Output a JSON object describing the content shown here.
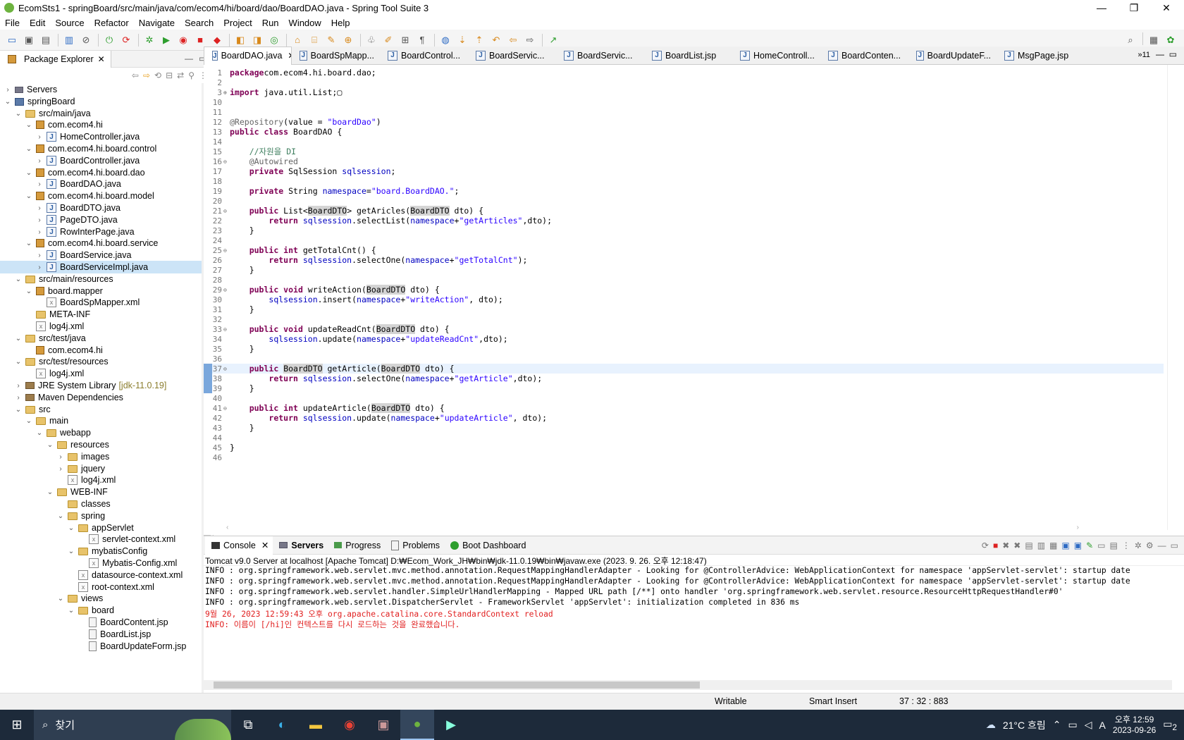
{
  "window": {
    "title": "EcomSts1 - springBoard/src/main/java/com/ecom4/hi/board/dao/BoardDAO.java - Spring Tool Suite 3",
    "minimize": "—",
    "maximize": "❐",
    "close": "✕"
  },
  "menu": [
    "File",
    "Edit",
    "Source",
    "Refactor",
    "Navigate",
    "Search",
    "Project",
    "Run",
    "Window",
    "Help"
  ],
  "package_explorer": {
    "tab_label": "Package Explorer",
    "tree": [
      {
        "depth": 0,
        "tw": "›",
        "icon": "srv",
        "label": "Servers"
      },
      {
        "depth": 0,
        "tw": "⌄",
        "icon": "proj",
        "label": "springBoard"
      },
      {
        "depth": 1,
        "tw": "⌄",
        "icon": "folder",
        "label": "src/main/java"
      },
      {
        "depth": 2,
        "tw": "⌄",
        "icon": "pkg",
        "label": "com.ecom4.hi"
      },
      {
        "depth": 3,
        "tw": "›",
        "icon": "java",
        "label": "HomeController.java"
      },
      {
        "depth": 2,
        "tw": "⌄",
        "icon": "pkg",
        "label": "com.ecom4.hi.board.control"
      },
      {
        "depth": 3,
        "tw": "›",
        "icon": "java",
        "label": "BoardController.java"
      },
      {
        "depth": 2,
        "tw": "⌄",
        "icon": "pkg",
        "label": "com.ecom4.hi.board.dao"
      },
      {
        "depth": 3,
        "tw": "›",
        "icon": "java",
        "label": "BoardDAO.java"
      },
      {
        "depth": 2,
        "tw": "⌄",
        "icon": "pkg",
        "label": "com.ecom4.hi.board.model"
      },
      {
        "depth": 3,
        "tw": "›",
        "icon": "java",
        "label": "BoardDTO.java"
      },
      {
        "depth": 3,
        "tw": "›",
        "icon": "java",
        "label": "PageDTO.java"
      },
      {
        "depth": 3,
        "tw": "›",
        "icon": "java",
        "label": "RowInterPage.java"
      },
      {
        "depth": 2,
        "tw": "⌄",
        "icon": "pkg",
        "label": "com.ecom4.hi.board.service"
      },
      {
        "depth": 3,
        "tw": "›",
        "icon": "java",
        "label": "BoardService.java"
      },
      {
        "depth": 3,
        "tw": "›",
        "icon": "java",
        "label": "BoardServiceImpl.java",
        "selected": true
      },
      {
        "depth": 1,
        "tw": "⌄",
        "icon": "folder",
        "label": "src/main/resources"
      },
      {
        "depth": 2,
        "tw": "⌄",
        "icon": "pkg",
        "label": "board.mapper"
      },
      {
        "depth": 3,
        "tw": "",
        "icon": "xml",
        "label": "BoardSpMapper.xml"
      },
      {
        "depth": 2,
        "tw": "",
        "icon": "folder",
        "label": "META-INF"
      },
      {
        "depth": 2,
        "tw": "",
        "icon": "xml",
        "label": "log4j.xml"
      },
      {
        "depth": 1,
        "tw": "⌄",
        "icon": "folder",
        "label": "src/test/java"
      },
      {
        "depth": 2,
        "tw": "",
        "icon": "pkg",
        "label": "com.ecom4.hi"
      },
      {
        "depth": 1,
        "tw": "⌄",
        "icon": "folder",
        "label": "src/test/resources"
      },
      {
        "depth": 2,
        "tw": "",
        "icon": "xml",
        "label": "log4j.xml"
      },
      {
        "depth": 1,
        "tw": "›",
        "icon": "lib",
        "label": "JRE System Library",
        "extra": "[jdk-11.0.19]"
      },
      {
        "depth": 1,
        "tw": "›",
        "icon": "lib",
        "label": "Maven Dependencies"
      },
      {
        "depth": 1,
        "tw": "⌄",
        "icon": "folder",
        "label": "src"
      },
      {
        "depth": 2,
        "tw": "⌄",
        "icon": "folder",
        "label": "main"
      },
      {
        "depth": 3,
        "tw": "⌄",
        "icon": "folder",
        "label": "webapp"
      },
      {
        "depth": 4,
        "tw": "⌄",
        "icon": "folder",
        "label": "resources"
      },
      {
        "depth": 5,
        "tw": "›",
        "icon": "folder",
        "label": "images"
      },
      {
        "depth": 5,
        "tw": "›",
        "icon": "folder",
        "label": "jquery"
      },
      {
        "depth": 5,
        "tw": "",
        "icon": "xml",
        "label": "log4j.xml"
      },
      {
        "depth": 4,
        "tw": "⌄",
        "icon": "folder",
        "label": "WEB-INF"
      },
      {
        "depth": 5,
        "tw": "",
        "icon": "folder",
        "label": "classes"
      },
      {
        "depth": 5,
        "tw": "⌄",
        "icon": "folder",
        "label": "spring"
      },
      {
        "depth": 6,
        "tw": "⌄",
        "icon": "folder",
        "label": "appServlet"
      },
      {
        "depth": 7,
        "tw": "",
        "icon": "xml",
        "label": "servlet-context.xml"
      },
      {
        "depth": 6,
        "tw": "⌄",
        "icon": "folder",
        "label": "mybatisConfig"
      },
      {
        "depth": 7,
        "tw": "",
        "icon": "xml",
        "label": "Mybatis-Config.xml"
      },
      {
        "depth": 6,
        "tw": "",
        "icon": "xml",
        "label": "datasource-context.xml"
      },
      {
        "depth": 6,
        "tw": "",
        "icon": "xml",
        "label": "root-context.xml"
      },
      {
        "depth": 5,
        "tw": "⌄",
        "icon": "folder",
        "label": "views"
      },
      {
        "depth": 6,
        "tw": "⌄",
        "icon": "folder",
        "label": "board"
      },
      {
        "depth": 7,
        "tw": "",
        "icon": "jsp",
        "label": "BoardContent.jsp"
      },
      {
        "depth": 7,
        "tw": "",
        "icon": "jsp",
        "label": "BoardList.jsp"
      },
      {
        "depth": 7,
        "tw": "",
        "icon": "jsp",
        "label": "BoardUpdateForm.jsp"
      }
    ]
  },
  "editor": {
    "tabs": [
      "BoardDAO.java",
      "BoardSpMapp...",
      "BoardControl...",
      "BoardServic...",
      "BoardServic...",
      "BoardList.jsp",
      "HomeControll...",
      "BoardConten...",
      "BoardUpdateF...",
      "MsgPage.jsp"
    ],
    "overflow_count": "»11",
    "lines": [
      {
        "n": "1",
        "toks": [
          [
            "kw",
            "package"
          ],
          [
            "",
            "com.ecom4.hi.board.dao;"
          ]
        ]
      },
      {
        "n": "2",
        "toks": []
      },
      {
        "n": "3",
        "fold": "⊕",
        "toks": [
          [
            "kw",
            "import"
          ],
          [
            "",
            " java.util.List;▢"
          ]
        ]
      },
      {
        "n": "10",
        "toks": []
      },
      {
        "n": "11",
        "toks": []
      },
      {
        "n": "12",
        "toks": [
          [
            "ann",
            "@Repository"
          ],
          [
            "",
            "(value = "
          ],
          [
            "str",
            "\"boardDao\""
          ],
          [
            "",
            ")"
          ]
        ]
      },
      {
        "n": "13",
        "toks": [
          [
            "kw",
            "public class"
          ],
          [
            "",
            " BoardDAO {"
          ]
        ]
      },
      {
        "n": "14",
        "toks": []
      },
      {
        "n": "15",
        "toks": [
          [
            "",
            "    "
          ],
          [
            "cmt",
            "//자원을 DI"
          ]
        ]
      },
      {
        "n": "16",
        "fold": "⊖",
        "toks": [
          [
            "",
            "    "
          ],
          [
            "ann",
            "@Autowired"
          ]
        ]
      },
      {
        "n": "17",
        "toks": [
          [
            "",
            "    "
          ],
          [
            "kw",
            "private"
          ],
          [
            "",
            " SqlSession "
          ],
          [
            "fld",
            "sqlsession"
          ],
          [
            "",
            ";"
          ]
        ]
      },
      {
        "n": "18",
        "toks": []
      },
      {
        "n": "19",
        "toks": [
          [
            "",
            "    "
          ],
          [
            "kw",
            "private"
          ],
          [
            "",
            " String "
          ],
          [
            "fld",
            "namespace"
          ],
          [
            "",
            "="
          ],
          [
            "str",
            "\"board.BoardDAO.\""
          ],
          [
            "",
            ";"
          ]
        ]
      },
      {
        "n": "20",
        "toks": []
      },
      {
        "n": "21",
        "fold": "⊖",
        "toks": [
          [
            "",
            "    "
          ],
          [
            "kw",
            "public"
          ],
          [
            "",
            " List<"
          ],
          [
            "hl",
            "BoardDTO"
          ],
          [
            "",
            "> getAricles("
          ],
          [
            "hl",
            "BoardDTO"
          ],
          [
            "",
            " dto) {"
          ]
        ]
      },
      {
        "n": "22",
        "toks": [
          [
            "",
            "        "
          ],
          [
            "kw",
            "return"
          ],
          [
            "",
            " "
          ],
          [
            "fld",
            "sqlsession"
          ],
          [
            "",
            ".selectList("
          ],
          [
            "fld",
            "namespace"
          ],
          [
            "",
            "+"
          ],
          [
            "str",
            "\"getArticles\""
          ],
          [
            "",
            ",dto);"
          ]
        ]
      },
      {
        "n": "23",
        "toks": [
          [
            "",
            "    }"
          ]
        ]
      },
      {
        "n": "24",
        "toks": []
      },
      {
        "n": "25",
        "fold": "⊖",
        "toks": [
          [
            "",
            "    "
          ],
          [
            "kw",
            "public int"
          ],
          [
            "",
            " getTotalCnt() {"
          ]
        ]
      },
      {
        "n": "26",
        "toks": [
          [
            "",
            "        "
          ],
          [
            "kw",
            "return"
          ],
          [
            "",
            " "
          ],
          [
            "fld",
            "sqlsession"
          ],
          [
            "",
            ".selectOne("
          ],
          [
            "fld",
            "namespace"
          ],
          [
            "",
            "+"
          ],
          [
            "str",
            "\"getTotalCnt\""
          ],
          [
            "",
            ");"
          ]
        ]
      },
      {
        "n": "27",
        "toks": [
          [
            "",
            "    }"
          ]
        ]
      },
      {
        "n": "28",
        "toks": []
      },
      {
        "n": "29",
        "fold": "⊖",
        "toks": [
          [
            "",
            "    "
          ],
          [
            "kw",
            "public void"
          ],
          [
            "",
            " writeAction("
          ],
          [
            "hl",
            "BoardDTO"
          ],
          [
            "",
            " dto) {"
          ]
        ]
      },
      {
        "n": "30",
        "toks": [
          [
            "",
            "        "
          ],
          [
            "fld",
            "sqlsession"
          ],
          [
            "",
            ".insert("
          ],
          [
            "fld",
            "namespace"
          ],
          [
            "",
            "+"
          ],
          [
            "str",
            "\"writeAction\""
          ],
          [
            "",
            ", dto);"
          ]
        ]
      },
      {
        "n": "31",
        "toks": [
          [
            "",
            "    }"
          ]
        ]
      },
      {
        "n": "32",
        "toks": []
      },
      {
        "n": "33",
        "fold": "⊖",
        "toks": [
          [
            "",
            "    "
          ],
          [
            "kw",
            "public void"
          ],
          [
            "",
            " updateReadCnt("
          ],
          [
            "hl",
            "BoardDTO"
          ],
          [
            "",
            " dto) {"
          ]
        ]
      },
      {
        "n": "34",
        "toks": [
          [
            "",
            "        "
          ],
          [
            "fld",
            "sqlsession"
          ],
          [
            "",
            ".update("
          ],
          [
            "fld",
            "namespace"
          ],
          [
            "",
            "+"
          ],
          [
            "str",
            "\"updateReadCnt\""
          ],
          [
            "",
            ",dto);"
          ]
        ]
      },
      {
        "n": "35",
        "toks": [
          [
            "",
            "    }"
          ]
        ]
      },
      {
        "n": "36",
        "toks": []
      },
      {
        "n": "37",
        "fold": "⊖",
        "cur": true,
        "toks": [
          [
            "",
            "    "
          ],
          [
            "kw",
            "public"
          ],
          [
            "",
            " "
          ],
          [
            "hl",
            "BoardDTO"
          ],
          [
            "",
            " getArticle("
          ],
          [
            "hl",
            "BoardDTO"
          ],
          [
            "",
            " dto) {"
          ]
        ]
      },
      {
        "n": "38",
        "toks": [
          [
            "",
            "        "
          ],
          [
            "kw",
            "return"
          ],
          [
            "",
            " "
          ],
          [
            "fld",
            "sqlsession"
          ],
          [
            "",
            ".selectOne("
          ],
          [
            "fld",
            "namespace"
          ],
          [
            "",
            "+"
          ],
          [
            "str",
            "\"getArticle\""
          ],
          [
            "",
            ",dto);"
          ]
        ]
      },
      {
        "n": "39",
        "toks": [
          [
            "",
            "    }"
          ]
        ]
      },
      {
        "n": "40",
        "toks": []
      },
      {
        "n": "41",
        "fold": "⊖",
        "toks": [
          [
            "",
            "    "
          ],
          [
            "kw",
            "public int"
          ],
          [
            "",
            " updateArticle("
          ],
          [
            "hl",
            "BoardDTO"
          ],
          [
            "",
            " dto) {"
          ]
        ]
      },
      {
        "n": "42",
        "toks": [
          [
            "",
            "        "
          ],
          [
            "kw",
            "return"
          ],
          [
            "",
            " "
          ],
          [
            "fld",
            "sqlsession"
          ],
          [
            "",
            ".update("
          ],
          [
            "fld",
            "namespace"
          ],
          [
            "",
            "+"
          ],
          [
            "str",
            "\"updateArticle\""
          ],
          [
            "",
            ", dto);"
          ]
        ]
      },
      {
        "n": "43",
        "toks": [
          [
            "",
            "    }"
          ]
        ]
      },
      {
        "n": "44",
        "toks": []
      },
      {
        "n": "45",
        "toks": [
          [
            "",
            "}"
          ]
        ]
      },
      {
        "n": "46",
        "toks": []
      }
    ]
  },
  "console": {
    "tabs": [
      "Console",
      "Servers",
      "Progress",
      "Problems",
      "Boot Dashboard"
    ],
    "description": "Tomcat v9.0 Server at localhost [Apache Tomcat] D:₩Ecom_Work_JH₩bin₩jdk-11.0.19₩bin₩javaw.exe  (2023. 9. 26. 오후 12:18:47)",
    "lines": [
      {
        "text": "INFO : org.springframework.web.servlet.mvc.method.annotation.RequestMappingHandlerAdapter - Looking for @ControllerAdvice: WebApplicationContext for namespace 'appServlet-servlet': startup date",
        "red": false
      },
      {
        "text": "INFO : org.springframework.web.servlet.mvc.method.annotation.RequestMappingHandlerAdapter - Looking for @ControllerAdvice: WebApplicationContext for namespace 'appServlet-servlet': startup date",
        "red": false
      },
      {
        "text": "INFO : org.springframework.web.servlet.handler.SimpleUrlHandlerMapping - Mapped URL path [/**] onto handler 'org.springframework.web.servlet.resource.ResourceHttpRequestHandler#0'",
        "red": false
      },
      {
        "text": "INFO : org.springframework.web.servlet.DispatcherServlet - FrameworkServlet 'appServlet': initialization completed in 836 ms",
        "red": false
      },
      {
        "text": "9월 26, 2023 12:59:43 오후 org.apache.catalina.core.StandardContext reload",
        "red": true
      },
      {
        "text": "INFO: 이름이 [/hi]인 컨텍스트를 다시 로드하는 것을 완료했습니다.",
        "red": true
      }
    ]
  },
  "status": {
    "writable": "Writable",
    "insert": "Smart Insert",
    "position": "37 : 32 : 883"
  },
  "taskbar": {
    "search_label": "찾기",
    "weather": "21°C 흐림",
    "time": "오후 12:59",
    "date": "2023-09-26",
    "ime": "A",
    "notification_count": "2"
  }
}
